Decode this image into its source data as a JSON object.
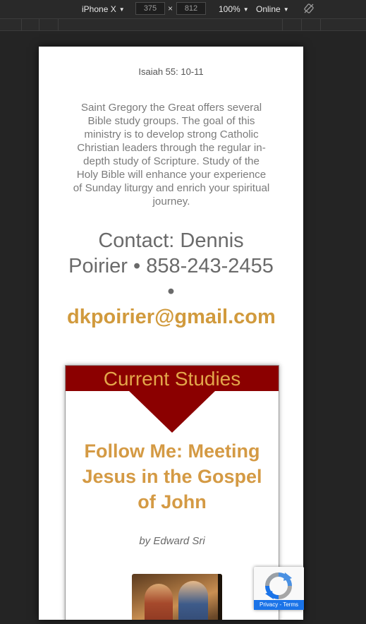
{
  "devtools": {
    "device": "iPhone X",
    "width": "375",
    "height": "812",
    "times_symbol": "×",
    "zoom": "100%",
    "network": "Online"
  },
  "page": {
    "scripture_ref": "Isaiah 55: 10-11",
    "intro": "Saint Gregory the Great offers several Bible study groups.  The goal of this ministry is to develop strong Catholic Christian leaders through the regular in-depth study of Scripture.  Study of the Holy Bible will enhance your experience of Sunday liturgy and enrich your spiritual journey.",
    "contact_prefix": "Contact:  Dennis Poirier • 858-243-2455 • ",
    "contact_email": "dkpoirier@gmail.com"
  },
  "card": {
    "header": "Current Studies",
    "study_title": "Follow Me: Meeting Jesus in the Gospel of John",
    "author": "by Edward Sri"
  },
  "recaptcha": {
    "footer": "Privacy - Terms"
  },
  "colors": {
    "accent": "#d19a3d",
    "header_red": "#8b0000"
  }
}
